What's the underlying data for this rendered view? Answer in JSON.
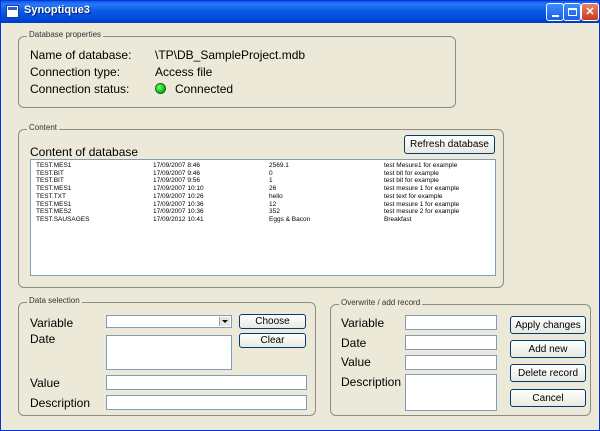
{
  "window": {
    "title": "Synoptique3"
  },
  "db_props": {
    "legend": "Database properties",
    "name_label": "Name of database:",
    "name_value": "\\TP\\DB_SampleProject.mdb",
    "conn_type_label": "Connection type:",
    "conn_type_value": "Access file",
    "status_label": "Connection status:",
    "status_value": "Connected",
    "status_color": "#12c112"
  },
  "content": {
    "legend": "Content",
    "heading": "Content of database",
    "refresh_label": "Refresh database",
    "rows": [
      [
        "TEST.MES1",
        "17/09/2007 8:46",
        "2569.1",
        "test Mesure1 for example"
      ],
      [
        "TEST.BIT",
        "17/09/2007 9:46",
        "0",
        "test bit for example"
      ],
      [
        "TEST.BIT",
        "17/09/2007 9:56",
        "1",
        "test bit for example"
      ],
      [
        "TEST.MES1",
        "17/09/2007 10:10",
        "26",
        "test mesure 1 for example"
      ],
      [
        "TEST.TXT",
        "17/09/2007 10:26",
        "hello",
        "test text for example"
      ],
      [
        "TEST.MES1",
        "17/09/2007 10:36",
        "12",
        "test mesure 1 for example"
      ],
      [
        "TEST.MES2",
        "17/09/2007 10:36",
        "352",
        "test mesure 2 for example"
      ],
      [
        "TEST.SAUSAGES",
        "17/09/2012 10:41",
        "Eggs & Bacon",
        "Breakfast"
      ]
    ]
  },
  "selection": {
    "legend": "Data selection",
    "variable_label": "Variable",
    "date_label": "Date",
    "value_label": "Value",
    "description_label": "Description",
    "choose_label": "Choose",
    "clear_label": "Clear"
  },
  "overwrite": {
    "legend": "Overwrite / add record",
    "variable_label": "Variable",
    "date_label": "Date",
    "value_label": "Value",
    "description_label": "Description",
    "apply_label": "Apply changes",
    "add_label": "Add new",
    "delete_label": "Delete record",
    "cancel_label": "Cancel"
  }
}
